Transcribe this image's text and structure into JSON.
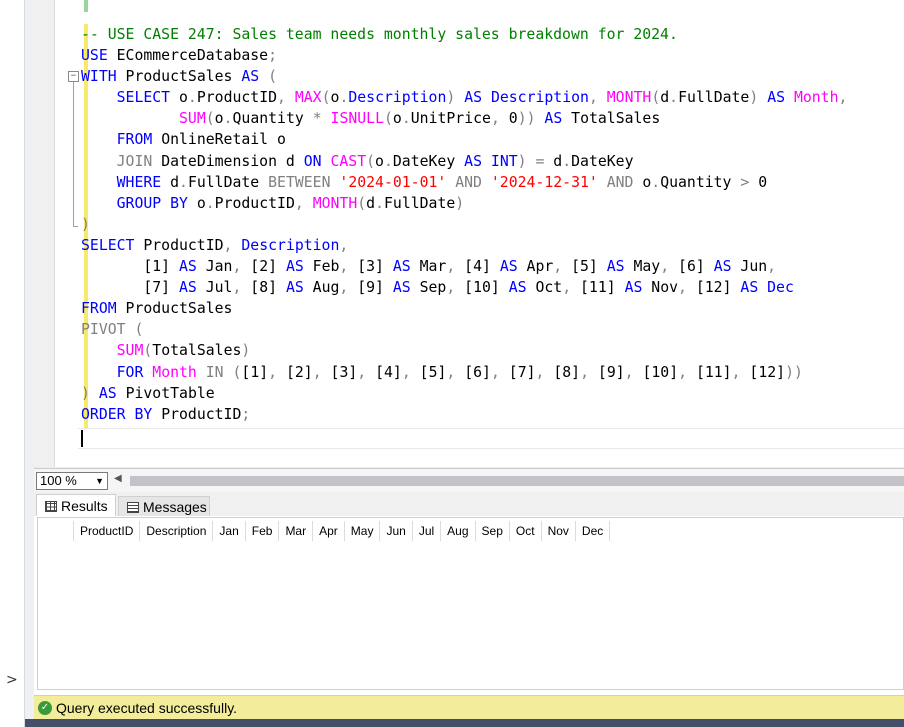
{
  "editor": {
    "lines": [
      [
        {
          "t": "-- USE CASE 247: Sales team needs monthly sales breakdown for 2024.",
          "c": "cm"
        }
      ],
      [
        {
          "t": "USE",
          "c": "kw"
        },
        {
          "t": " ECommerceDatabase",
          "c": "tx"
        },
        {
          "t": ";",
          "c": "op"
        }
      ],
      [
        {
          "t": "WITH",
          "c": "kw"
        },
        {
          "t": " ProductSales ",
          "c": "tx"
        },
        {
          "t": "AS",
          "c": "kw"
        },
        {
          "t": " (",
          "c": "op"
        }
      ],
      [
        {
          "t": "    ",
          "c": "tx"
        },
        {
          "t": "SELECT",
          "c": "kw"
        },
        {
          "t": " o",
          "c": "tx"
        },
        {
          "t": ".",
          "c": "op"
        },
        {
          "t": "ProductID",
          "c": "tx"
        },
        {
          "t": ", ",
          "c": "op"
        },
        {
          "t": "MAX",
          "c": "fn"
        },
        {
          "t": "(",
          "c": "op"
        },
        {
          "t": "o",
          "c": "tx"
        },
        {
          "t": ".",
          "c": "op"
        },
        {
          "t": "Description",
          "c": "kw"
        },
        {
          "t": ") ",
          "c": "op"
        },
        {
          "t": "AS",
          "c": "kw"
        },
        {
          "t": " ",
          "c": "tx"
        },
        {
          "t": "Description",
          "c": "kw"
        },
        {
          "t": ", ",
          "c": "op"
        },
        {
          "t": "MONTH",
          "c": "fn"
        },
        {
          "t": "(",
          "c": "op"
        },
        {
          "t": "d",
          "c": "tx"
        },
        {
          "t": ".",
          "c": "op"
        },
        {
          "t": "FullDate",
          "c": "tx"
        },
        {
          "t": ") ",
          "c": "op"
        },
        {
          "t": "AS",
          "c": "kw"
        },
        {
          "t": " ",
          "c": "tx"
        },
        {
          "t": "Month",
          "c": "fn"
        },
        {
          "t": ",",
          "c": "op"
        }
      ],
      [
        {
          "t": "           ",
          "c": "tx"
        },
        {
          "t": "SUM",
          "c": "fn"
        },
        {
          "t": "(",
          "c": "op"
        },
        {
          "t": "o",
          "c": "tx"
        },
        {
          "t": ".",
          "c": "op"
        },
        {
          "t": "Quantity ",
          "c": "tx"
        },
        {
          "t": "*",
          "c": "op"
        },
        {
          "t": " ",
          "c": "tx"
        },
        {
          "t": "ISNULL",
          "c": "fn"
        },
        {
          "t": "(",
          "c": "op"
        },
        {
          "t": "o",
          "c": "tx"
        },
        {
          "t": ".",
          "c": "op"
        },
        {
          "t": "UnitPrice",
          "c": "tx"
        },
        {
          "t": ", ",
          "c": "op"
        },
        {
          "t": "0",
          "c": "tx"
        },
        {
          "t": ")) ",
          "c": "op"
        },
        {
          "t": "AS",
          "c": "kw"
        },
        {
          "t": " TotalSales",
          "c": "tx"
        }
      ],
      [
        {
          "t": "    ",
          "c": "tx"
        },
        {
          "t": "FROM",
          "c": "kw"
        },
        {
          "t": " OnlineRetail o",
          "c": "tx"
        }
      ],
      [
        {
          "t": "    ",
          "c": "tx"
        },
        {
          "t": "JOIN",
          "c": "op"
        },
        {
          "t": " DateDimension d ",
          "c": "tx"
        },
        {
          "t": "ON",
          "c": "kw"
        },
        {
          "t": " ",
          "c": "tx"
        },
        {
          "t": "CAST",
          "c": "fn"
        },
        {
          "t": "(",
          "c": "op"
        },
        {
          "t": "o",
          "c": "tx"
        },
        {
          "t": ".",
          "c": "op"
        },
        {
          "t": "DateKey ",
          "c": "tx"
        },
        {
          "t": "AS",
          "c": "kw"
        },
        {
          "t": " ",
          "c": "tx"
        },
        {
          "t": "INT",
          "c": "kw"
        },
        {
          "t": ") = ",
          "c": "op"
        },
        {
          "t": "d",
          "c": "tx"
        },
        {
          "t": ".",
          "c": "op"
        },
        {
          "t": "DateKey",
          "c": "tx"
        }
      ],
      [
        {
          "t": "    ",
          "c": "tx"
        },
        {
          "t": "WHERE",
          "c": "kw"
        },
        {
          "t": " d",
          "c": "tx"
        },
        {
          "t": ".",
          "c": "op"
        },
        {
          "t": "FullDate ",
          "c": "tx"
        },
        {
          "t": "BETWEEN",
          "c": "op"
        },
        {
          "t": " ",
          "c": "tx"
        },
        {
          "t": "'2024-01-01'",
          "c": "st"
        },
        {
          "t": " ",
          "c": "tx"
        },
        {
          "t": "AND",
          "c": "op"
        },
        {
          "t": " ",
          "c": "tx"
        },
        {
          "t": "'2024-12-31'",
          "c": "st"
        },
        {
          "t": " ",
          "c": "tx"
        },
        {
          "t": "AND",
          "c": "op"
        },
        {
          "t": " o",
          "c": "tx"
        },
        {
          "t": ".",
          "c": "op"
        },
        {
          "t": "Quantity ",
          "c": "tx"
        },
        {
          "t": ">",
          "c": "op"
        },
        {
          "t": " 0",
          "c": "tx"
        }
      ],
      [
        {
          "t": "    ",
          "c": "tx"
        },
        {
          "t": "GROUP BY",
          "c": "kw"
        },
        {
          "t": " o",
          "c": "tx"
        },
        {
          "t": ".",
          "c": "op"
        },
        {
          "t": "ProductID",
          "c": "tx"
        },
        {
          "t": ", ",
          "c": "op"
        },
        {
          "t": "MONTH",
          "c": "fn"
        },
        {
          "t": "(",
          "c": "op"
        },
        {
          "t": "d",
          "c": "tx"
        },
        {
          "t": ".",
          "c": "op"
        },
        {
          "t": "FullDate",
          "c": "tx"
        },
        {
          "t": ")",
          "c": "op"
        }
      ],
      [
        {
          "t": ")",
          "c": "op"
        }
      ],
      [
        {
          "t": "SELECT",
          "c": "kw"
        },
        {
          "t": " ProductID",
          "c": "tx"
        },
        {
          "t": ", ",
          "c": "op"
        },
        {
          "t": "Description",
          "c": "kw"
        },
        {
          "t": ",",
          "c": "op"
        }
      ],
      [
        {
          "t": "       [1] ",
          "c": "tx"
        },
        {
          "t": "AS",
          "c": "kw"
        },
        {
          "t": " Jan",
          "c": "tx"
        },
        {
          "t": ", ",
          "c": "op"
        },
        {
          "t": "[2] ",
          "c": "tx"
        },
        {
          "t": "AS",
          "c": "kw"
        },
        {
          "t": " Feb",
          "c": "tx"
        },
        {
          "t": ", ",
          "c": "op"
        },
        {
          "t": "[3] ",
          "c": "tx"
        },
        {
          "t": "AS",
          "c": "kw"
        },
        {
          "t": " Mar",
          "c": "tx"
        },
        {
          "t": ", ",
          "c": "op"
        },
        {
          "t": "[4] ",
          "c": "tx"
        },
        {
          "t": "AS",
          "c": "kw"
        },
        {
          "t": " Apr",
          "c": "tx"
        },
        {
          "t": ", ",
          "c": "op"
        },
        {
          "t": "[5] ",
          "c": "tx"
        },
        {
          "t": "AS",
          "c": "kw"
        },
        {
          "t": " May",
          "c": "tx"
        },
        {
          "t": ", ",
          "c": "op"
        },
        {
          "t": "[6] ",
          "c": "tx"
        },
        {
          "t": "AS",
          "c": "kw"
        },
        {
          "t": " Jun",
          "c": "tx"
        },
        {
          "t": ",",
          "c": "op"
        }
      ],
      [
        {
          "t": "       [7] ",
          "c": "tx"
        },
        {
          "t": "AS",
          "c": "kw"
        },
        {
          "t": " Jul",
          "c": "tx"
        },
        {
          "t": ", ",
          "c": "op"
        },
        {
          "t": "[8] ",
          "c": "tx"
        },
        {
          "t": "AS",
          "c": "kw"
        },
        {
          "t": " Aug",
          "c": "tx"
        },
        {
          "t": ", ",
          "c": "op"
        },
        {
          "t": "[9] ",
          "c": "tx"
        },
        {
          "t": "AS",
          "c": "kw"
        },
        {
          "t": " Sep",
          "c": "tx"
        },
        {
          "t": ", ",
          "c": "op"
        },
        {
          "t": "[10] ",
          "c": "tx"
        },
        {
          "t": "AS",
          "c": "kw"
        },
        {
          "t": " Oct",
          "c": "tx"
        },
        {
          "t": ", ",
          "c": "op"
        },
        {
          "t": "[11] ",
          "c": "tx"
        },
        {
          "t": "AS",
          "c": "kw"
        },
        {
          "t": " Nov",
          "c": "tx"
        },
        {
          "t": ", ",
          "c": "op"
        },
        {
          "t": "[12] ",
          "c": "tx"
        },
        {
          "t": "AS",
          "c": "kw"
        },
        {
          "t": " Dec",
          "c": "kw"
        }
      ],
      [
        {
          "t": "FROM",
          "c": "kw"
        },
        {
          "t": " ProductSales",
          "c": "tx"
        }
      ],
      [
        {
          "t": "PIVOT",
          "c": "op"
        },
        {
          "t": " (",
          "c": "op"
        }
      ],
      [
        {
          "t": "    ",
          "c": "tx"
        },
        {
          "t": "SUM",
          "c": "fn"
        },
        {
          "t": "(",
          "c": "op"
        },
        {
          "t": "TotalSales",
          "c": "tx"
        },
        {
          "t": ")",
          "c": "op"
        }
      ],
      [
        {
          "t": "    ",
          "c": "tx"
        },
        {
          "t": "FOR",
          "c": "kw"
        },
        {
          "t": " ",
          "c": "tx"
        },
        {
          "t": "Month",
          "c": "fn"
        },
        {
          "t": " ",
          "c": "tx"
        },
        {
          "t": "IN",
          "c": "op"
        },
        {
          "t": " (",
          "c": "op"
        },
        {
          "t": "[1]",
          "c": "tx"
        },
        {
          "t": ", ",
          "c": "op"
        },
        {
          "t": "[2]",
          "c": "tx"
        },
        {
          "t": ", ",
          "c": "op"
        },
        {
          "t": "[3]",
          "c": "tx"
        },
        {
          "t": ", ",
          "c": "op"
        },
        {
          "t": "[4]",
          "c": "tx"
        },
        {
          "t": ", ",
          "c": "op"
        },
        {
          "t": "[5]",
          "c": "tx"
        },
        {
          "t": ", ",
          "c": "op"
        },
        {
          "t": "[6]",
          "c": "tx"
        },
        {
          "t": ", ",
          "c": "op"
        },
        {
          "t": "[7]",
          "c": "tx"
        },
        {
          "t": ", ",
          "c": "op"
        },
        {
          "t": "[8]",
          "c": "tx"
        },
        {
          "t": ", ",
          "c": "op"
        },
        {
          "t": "[9]",
          "c": "tx"
        },
        {
          "t": ", ",
          "c": "op"
        },
        {
          "t": "[10]",
          "c": "tx"
        },
        {
          "t": ", ",
          "c": "op"
        },
        {
          "t": "[11]",
          "c": "tx"
        },
        {
          "t": ", ",
          "c": "op"
        },
        {
          "t": "[12]",
          "c": "tx"
        },
        {
          "t": "))",
          "c": "op"
        }
      ],
      [
        {
          "t": ")",
          "c": "op"
        },
        {
          "t": " ",
          "c": "tx"
        },
        {
          "t": "AS",
          "c": "kw"
        },
        {
          "t": " PivotTable",
          "c": "tx"
        }
      ],
      [
        {
          "t": "ORDER BY",
          "c": "kw"
        },
        {
          "t": " ProductID",
          "c": "tx"
        },
        {
          "t": ";",
          "c": "op"
        }
      ]
    ]
  },
  "zoom": {
    "value": "100 %"
  },
  "results": {
    "tabs": [
      "Results",
      "Messages"
    ],
    "columns": [
      "ProductID",
      "Description",
      "Jan",
      "Feb",
      "Mar",
      "Apr",
      "May",
      "Jun",
      "Jul",
      "Aug",
      "Sep",
      "Oct",
      "Nov",
      "Dec"
    ]
  },
  "status": {
    "text": "Query executed successfully.",
    "icon": "check-circle-icon",
    "color": "#f3ec9b"
  },
  "icons": {
    "collapse": "minus-box-icon",
    "expand": "chevron-right-icon",
    "dropdown": "chevron-down-icon",
    "scroll_left": "triangle-left-icon",
    "grid": "grid-icon",
    "messages": "messages-icon"
  }
}
